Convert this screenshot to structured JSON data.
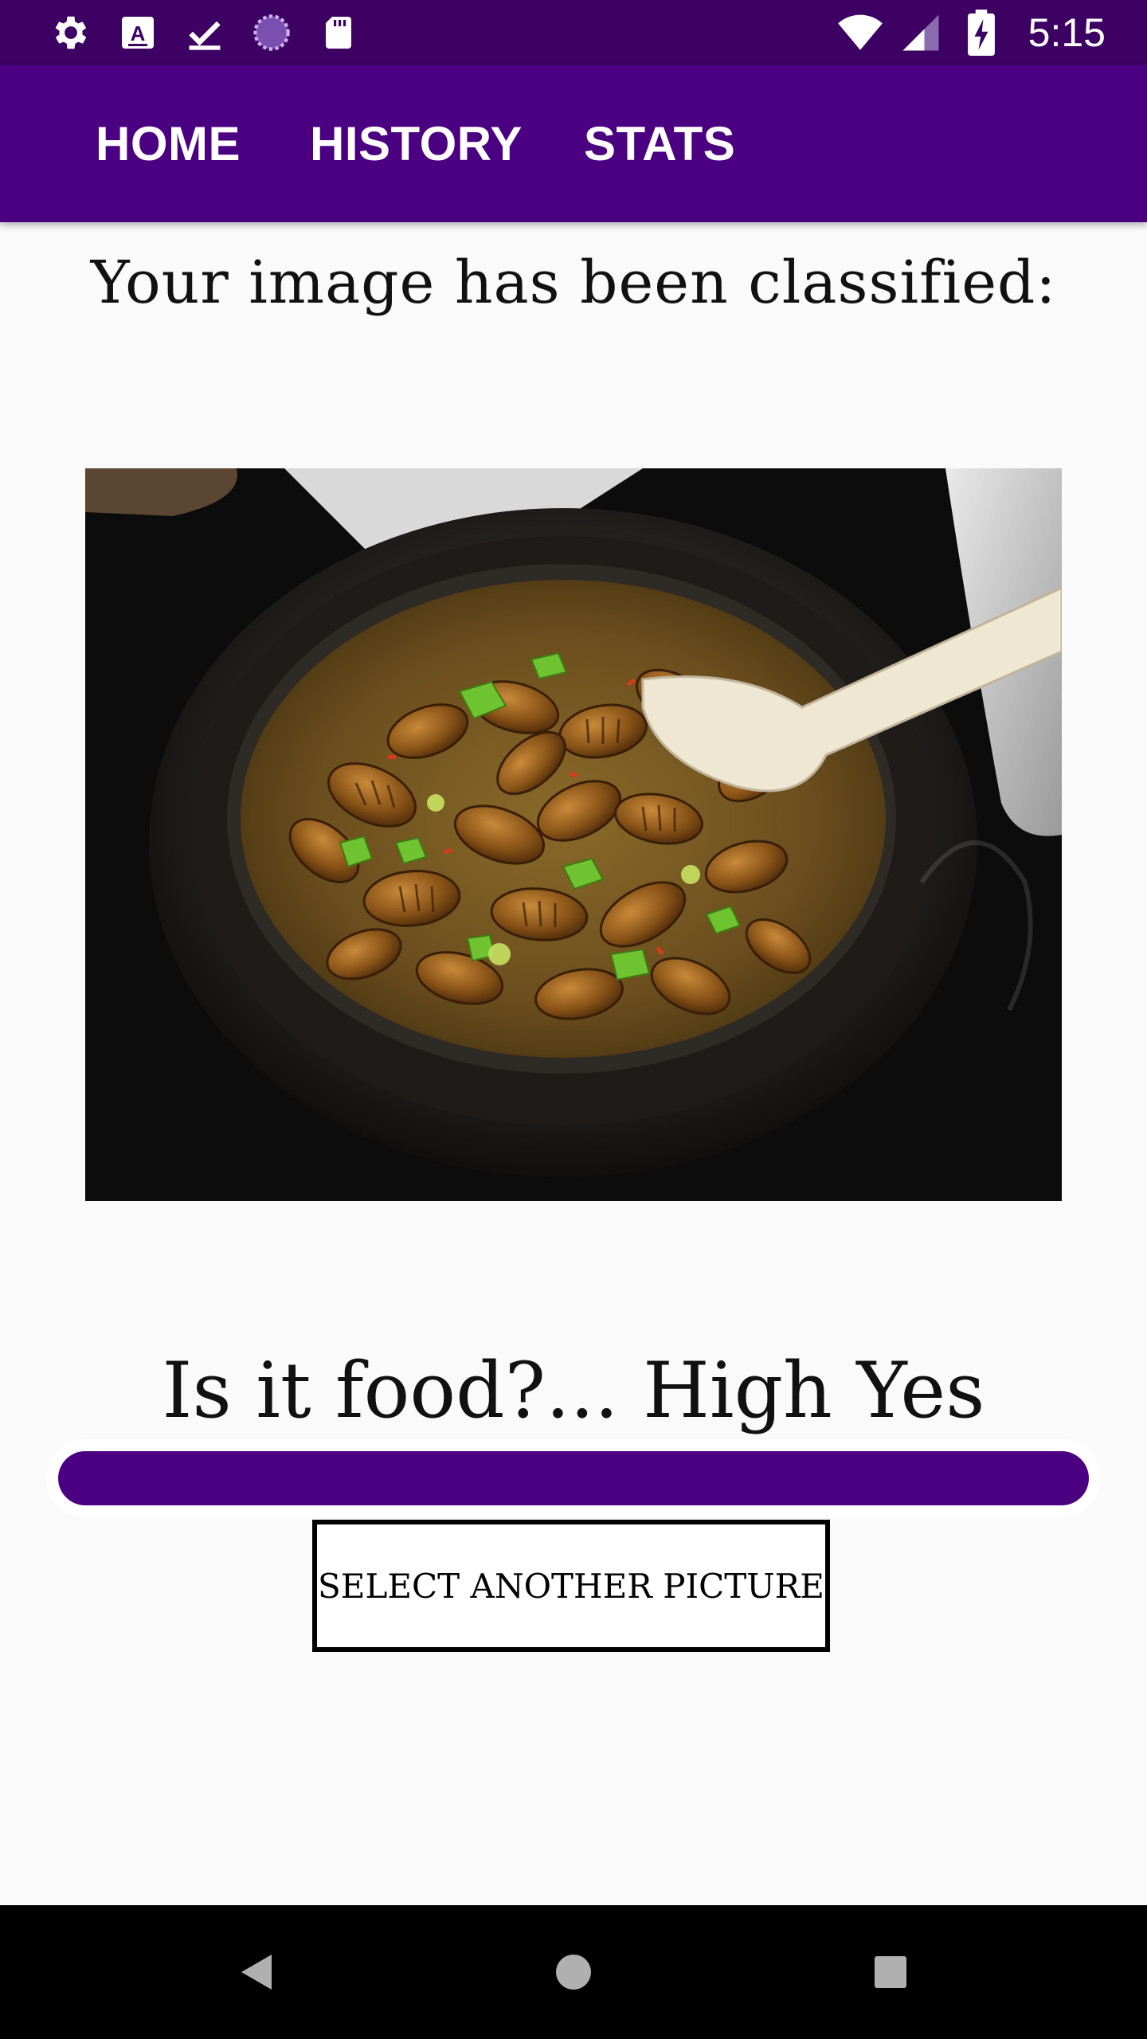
{
  "status_bar": {
    "time": "5:15",
    "left_icons": [
      "settings-icon",
      "text-a-icon",
      "download-done-icon",
      "sync-circle-icon",
      "sd-card-icon"
    ],
    "right_icons": [
      "wifi-icon",
      "cell-signal-icon",
      "battery-charging-icon"
    ]
  },
  "app_bar": {
    "tabs": [
      {
        "label": "HOME"
      },
      {
        "label": "HISTORY"
      },
      {
        "label": "STATS"
      }
    ],
    "background_color": "#4a0080"
  },
  "main": {
    "heading": "Your image has been classified:",
    "image_subject": "food-photo",
    "result_text": "Is it food?... High Yes",
    "confidence_progress": 1.0,
    "select_button_label": "SELECT ANOTHER PICTURE",
    "accent_color": "#4a0080"
  },
  "nav_bar": {
    "buttons": [
      "back-icon",
      "home-icon",
      "recents-icon"
    ]
  }
}
